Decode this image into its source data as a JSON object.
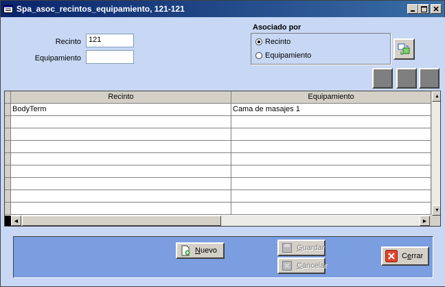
{
  "window": {
    "title": "Spa_asoc_recintos_equipamiento, 121-121"
  },
  "form": {
    "recinto_label": "Recinto",
    "recinto_value": "121",
    "equipamiento_label": "Equipamiento",
    "equipamiento_value": ""
  },
  "asociado": {
    "title": "Asociado por",
    "options": [
      {
        "label": "Recinto",
        "selected": true
      },
      {
        "label": "Equipamiento",
        "selected": false
      }
    ]
  },
  "grid": {
    "columns": [
      "Recinto",
      "Equipamiento"
    ],
    "rows": [
      [
        "BodyTerm",
        "Cama de masajes 1"
      ],
      [
        "",
        ""
      ],
      [
        "",
        ""
      ],
      [
        "",
        ""
      ],
      [
        "",
        ""
      ],
      [
        "",
        ""
      ],
      [
        "",
        ""
      ],
      [
        "",
        ""
      ],
      [
        "",
        ""
      ]
    ]
  },
  "buttons": {
    "nuevo_first": "N",
    "nuevo_rest": "uevo",
    "guardar_first": "G",
    "guardar_rest": "uardar",
    "cancelar_first": "C",
    "cancelar_rest": "ancelar",
    "cerrar_pre": "C",
    "cerrar_u": "e",
    "cerrar_rest": "rrar"
  },
  "colors": {
    "titlebar": "#0a246a",
    "background": "#c7d7f4",
    "panel": "#7b9ee0"
  }
}
